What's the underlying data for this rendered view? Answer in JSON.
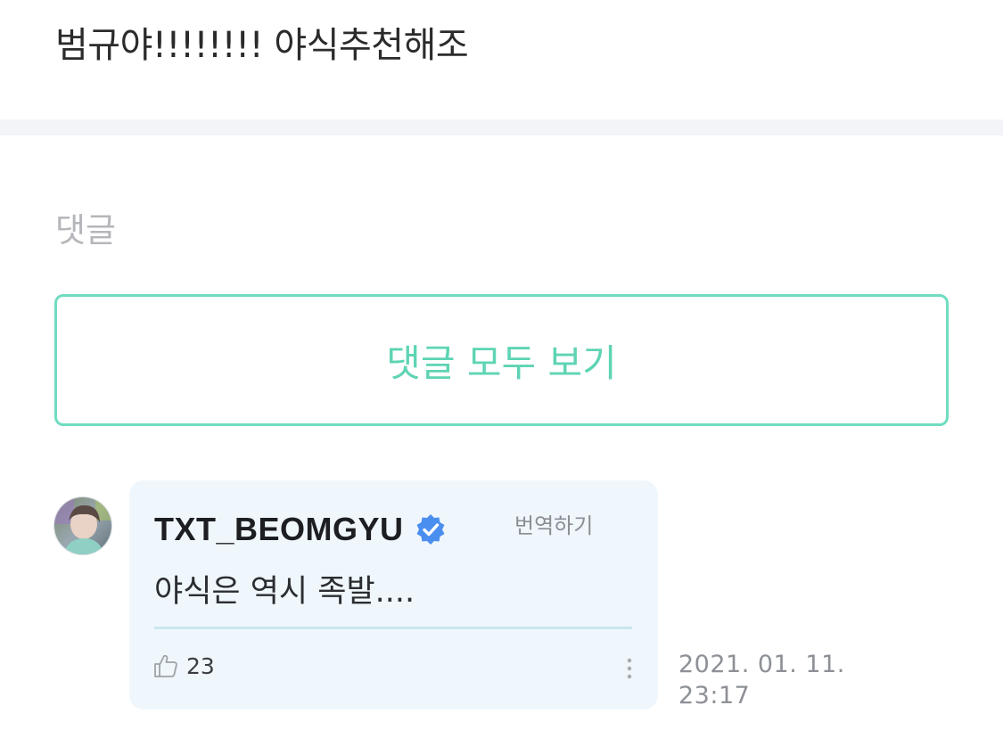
{
  "post": {
    "text": "범규야!!!!!!!! 야식추천해조"
  },
  "comments": {
    "heading": "댓글",
    "view_all_label": "댓글 모두 보기",
    "items": [
      {
        "author": "TXT_BEOMGYU",
        "verified_icon": "verified-badge-icon",
        "translate_label": "번역하기",
        "text": "야식은 역시 족발....",
        "likes": "23",
        "date": "2021. 01. 11.",
        "time": "23:17"
      }
    ]
  },
  "colors": {
    "accent": "#5ed4b4",
    "card_background": "#eff7fc",
    "verified": "#4a8ef0"
  }
}
